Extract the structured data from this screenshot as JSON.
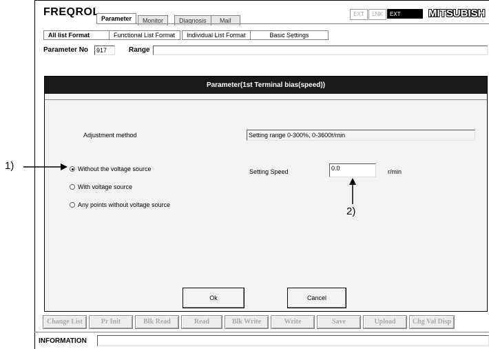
{
  "app": {
    "title": "FREQROL",
    "brand": "MITSUBISH"
  },
  "main_tabs": [
    "Parameter",
    "Monitor",
    "Diagnosis",
    "Mail"
  ],
  "mode_indicators": [
    "EXT",
    "LNK",
    "EXT"
  ],
  "sub_tabs": [
    "All list Format",
    "Functional List Format",
    "Individual List Format",
    "Basic Settings"
  ],
  "parameter_row": {
    "no_label": "Parameter No",
    "no_value": "917",
    "range_label": "Range",
    "range_value": ""
  },
  "dialog": {
    "title": "Parameter(1st Terminal bias(speed))",
    "adjustment_label": "Adjustment method",
    "range_text": "Setting range 0-300%, 0-3600r/min",
    "options": [
      "Without the voltage source",
      "With voltage source",
      "Any points without voltage source"
    ],
    "selected_option": 0,
    "speed_label": "Setting Speed",
    "speed_value": "0.0",
    "speed_unit": "r/min",
    "ok_label": "Ok",
    "cancel_label": "Cancel"
  },
  "function_buttons": [
    "Change List",
    "Pr Init",
    "Blk Read",
    "Read",
    "Blk Write",
    "Write",
    "Save",
    "Upload",
    "Chg Val Disp"
  ],
  "information": {
    "label": "INFORMATION",
    "value": ""
  },
  "callouts": {
    "c1": "1)",
    "c2": "2)"
  },
  "colors": {
    "dialog_header": "#1a1a1a",
    "disabled_text": "#aaaaaa"
  }
}
